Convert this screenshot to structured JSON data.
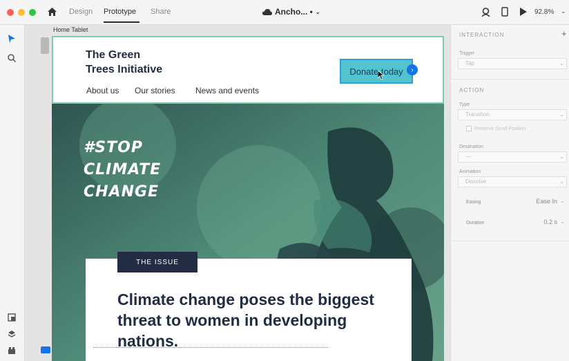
{
  "titlebar": {
    "traffic_lights": [
      "#ff5f57",
      "#febc2e",
      "#28c840"
    ],
    "tabs": [
      "Design",
      "Prototype",
      "Share"
    ],
    "doc_title": "Ancho... •",
    "zoom": "92.8%"
  },
  "canvas": {
    "artboard_label": "Home Tablet"
  },
  "site": {
    "logo_line1": "The Green",
    "logo_line2": "Trees Initiative",
    "nav": [
      "About us",
      "Our stories",
      "News and events"
    ],
    "donate_label": "Donate today",
    "hero_lines": [
      "#STOP",
      "CLIMATE",
      "CHANGE"
    ],
    "issue_tag": "THE ISSUE",
    "headline": "Climate change poses the biggest threat to women in developing nations."
  },
  "panel": {
    "interaction_title": "INTERACTION",
    "trigger_label": "Trigger",
    "trigger_value": "Tap",
    "action_title": "ACTION",
    "type_label": "Type",
    "type_value": "Transition",
    "preserve_label": "Preserve Scroll Position",
    "destination_label": "Destination",
    "destination_value": "—",
    "animation_label": "Animation",
    "animation_value": "Dissolve",
    "easing_label": "Easing",
    "easing_value": "Ease In",
    "duration_label": "Duration",
    "duration_value": "0.2 s"
  },
  "colors": {
    "accent": "#1473e6",
    "navy": "#222d44",
    "teal": "#52c4cf",
    "hero": "#3d6b63",
    "mint": "#7bcfa8"
  }
}
